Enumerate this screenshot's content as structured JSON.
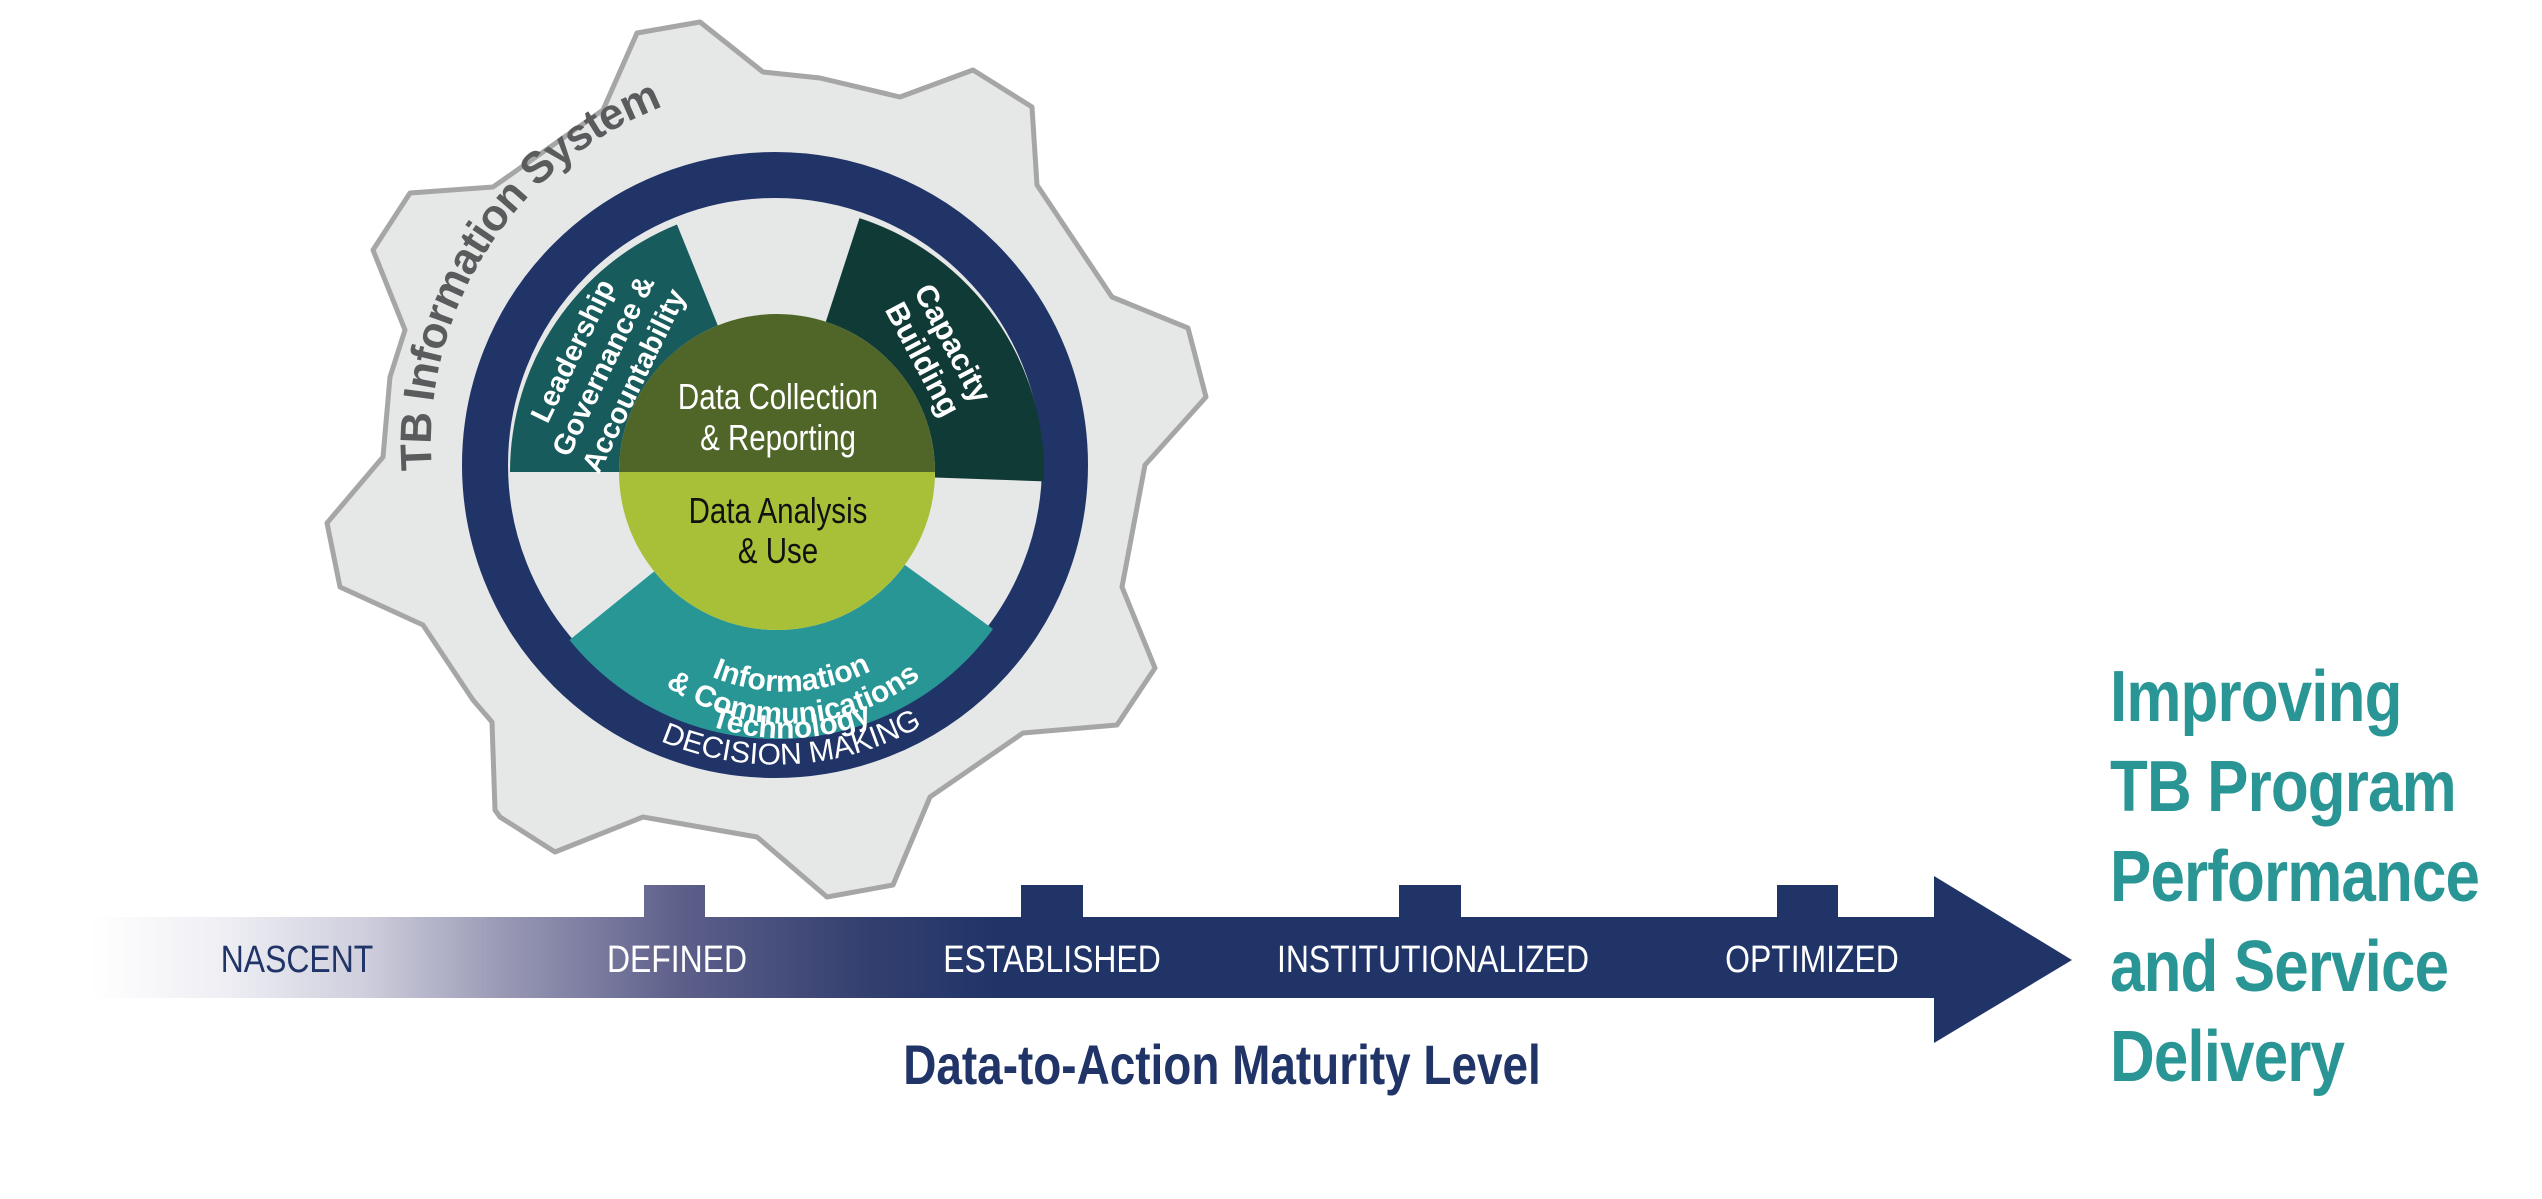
{
  "gear": {
    "title": "TB Information System",
    "ring_label": "DECISION MAKING",
    "core": {
      "top": [
        "Data Collection",
        "& Reporting"
      ],
      "bottom": [
        "Data Analysis",
        "& Use"
      ]
    },
    "sectors": {
      "leadership": [
        "Leadership",
        "Governance &",
        "Accountability"
      ],
      "capacity": [
        "Capacity",
        "Building"
      ],
      "ict": [
        "Information",
        "& Communications",
        "Technology"
      ]
    }
  },
  "maturity": {
    "axis_title": "Data-to-Action Maturity Level",
    "levels": [
      "NASCENT",
      "DEFINED",
      "ESTABLISHED",
      "INSTITUTIONALIZED",
      "OPTIMIZED"
    ]
  },
  "outcome": {
    "lines": [
      "Improving",
      "TB Program",
      "Performance",
      "and Service",
      "Delivery"
    ]
  },
  "colors": {
    "navy": "#203468",
    "gear_fill": "#e6e7e7",
    "gear_stroke": "#a6a6a6",
    "leadership": "#185b5c",
    "capacity": "#103a36",
    "ict": "#299696",
    "core_top": "#4f6628",
    "core_bottom": "#a7c038",
    "title_gray": "#5a5b5d",
    "outcome_teal": "#2a9595"
  }
}
